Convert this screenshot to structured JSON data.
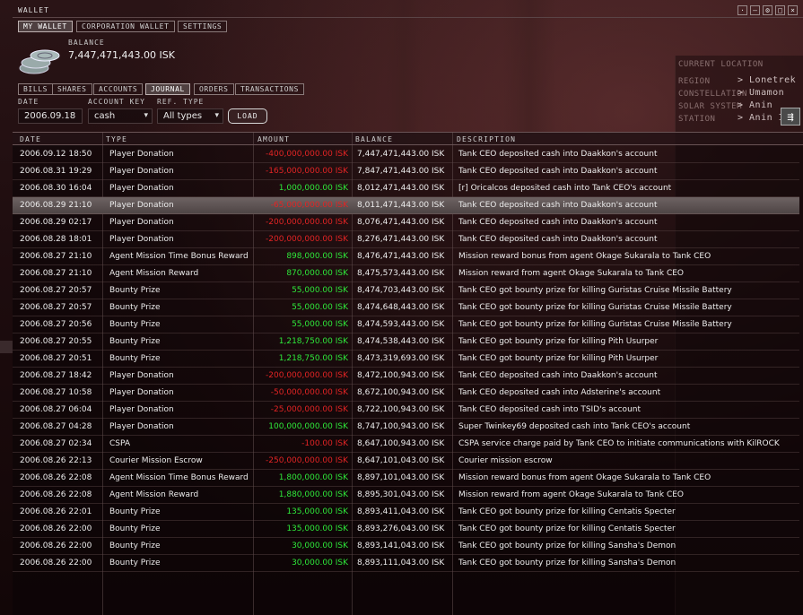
{
  "window": {
    "title": "WALLET"
  },
  "tabs_top": [
    "MY WALLET",
    "CORPORATION WALLET",
    "SETTINGS"
  ],
  "balance": {
    "label": "BALANCE",
    "value": "7,447,471,443.00 ISK"
  },
  "tabs_sub": [
    "BILLS",
    "SHARES",
    "ACCOUNTS",
    "JOURNAL",
    "ORDERS",
    "TRANSACTIONS"
  ],
  "filters": {
    "date_label": "DATE",
    "date_value": "2006.09.18",
    "account_label": "ACCOUNT KEY",
    "account_value": "cash",
    "ref_label": "REF. TYPE",
    "ref_value": "All types",
    "load_label": "LOAD"
  },
  "location": {
    "heading": "CURRENT LOCATION",
    "region_label": "REGION",
    "region_value": "> Lonetrek",
    "constellation_label": "CONSTELLATION",
    "constellation_value": "> Umamon",
    "system_label": "SOLAR SYSTEM",
    "system_value": "> Anin",
    "station_label": "STATION",
    "station_value": "> Anin IX"
  },
  "columns": [
    "DATE",
    "TYPE",
    "AMOUNT",
    "BALANCE",
    "DESCRIPTION"
  ],
  "rows": [
    {
      "date": "2006.09.12 18:50",
      "type": "Player Donation",
      "amount": "-400,000,000.00 ISK",
      "sign": "neg",
      "balance": "7,447,471,443.00 ISK",
      "desc": "Tank CEO deposited cash into Daakkon's account"
    },
    {
      "date": "2006.08.31 19:29",
      "type": "Player Donation",
      "amount": "-165,000,000.00 ISK",
      "sign": "neg",
      "balance": "7,847,471,443.00 ISK",
      "desc": "Tank CEO deposited cash into Daakkon's account"
    },
    {
      "date": "2006.08.30 16:04",
      "type": "Player Donation",
      "amount": "1,000,000.00 ISK",
      "sign": "pos",
      "balance": "8,012,471,443.00 ISK",
      "desc": "[r] Oricalcos deposited cash into Tank CEO's account"
    },
    {
      "date": "2006.08.29 21:10",
      "type": "Player Donation",
      "amount": "-65,000,000.00 ISK",
      "sign": "neg",
      "balance": "8,011,471,443.00 ISK",
      "desc": "Tank CEO deposited cash into Daakkon's account",
      "selected": true
    },
    {
      "date": "2006.08.29 02:17",
      "type": "Player Donation",
      "amount": "-200,000,000.00 ISK",
      "sign": "neg",
      "balance": "8,076,471,443.00 ISK",
      "desc": "Tank CEO deposited cash into Daakkon's account"
    },
    {
      "date": "2006.08.28 18:01",
      "type": "Player Donation",
      "amount": "-200,000,000.00 ISK",
      "sign": "neg",
      "balance": "8,276,471,443.00 ISK",
      "desc": "Tank CEO deposited cash into Daakkon's account"
    },
    {
      "date": "2006.08.27 21:10",
      "type": "Agent Mission Time Bonus Reward",
      "amount": "898,000.00 ISK",
      "sign": "pos",
      "balance": "8,476,471,443.00 ISK",
      "desc": "Mission reward bonus from agent Okage Sukarala to Tank CEO"
    },
    {
      "date": "2006.08.27 21:10",
      "type": "Agent Mission Reward",
      "amount": "870,000.00 ISK",
      "sign": "pos",
      "balance": "8,475,573,443.00 ISK",
      "desc": "Mission reward from agent Okage Sukarala to Tank CEO"
    },
    {
      "date": "2006.08.27 20:57",
      "type": "Bounty Prize",
      "amount": "55,000.00 ISK",
      "sign": "pos",
      "balance": "8,474,703,443.00 ISK",
      "desc": "Tank CEO got bounty prize for killing Guristas Cruise Missile Battery"
    },
    {
      "date": "2006.08.27 20:57",
      "type": "Bounty Prize",
      "amount": "55,000.00 ISK",
      "sign": "pos",
      "balance": "8,474,648,443.00 ISK",
      "desc": "Tank CEO got bounty prize for killing Guristas Cruise Missile Battery"
    },
    {
      "date": "2006.08.27 20:56",
      "type": "Bounty Prize",
      "amount": "55,000.00 ISK",
      "sign": "pos",
      "balance": "8,474,593,443.00 ISK",
      "desc": "Tank CEO got bounty prize for killing Guristas Cruise Missile Battery"
    },
    {
      "date": "2006.08.27 20:55",
      "type": "Bounty Prize",
      "amount": "1,218,750.00 ISK",
      "sign": "pos",
      "balance": "8,474,538,443.00 ISK",
      "desc": "Tank CEO got bounty prize for killing Pith Usurper"
    },
    {
      "date": "2006.08.27 20:51",
      "type": "Bounty Prize",
      "amount": "1,218,750.00 ISK",
      "sign": "pos",
      "balance": "8,473,319,693.00 ISK",
      "desc": "Tank CEO got bounty prize for killing Pith Usurper"
    },
    {
      "date": "2006.08.27 18:42",
      "type": "Player Donation",
      "amount": "-200,000,000.00 ISK",
      "sign": "neg",
      "balance": "8,472,100,943.00 ISK",
      "desc": "Tank CEO deposited cash into Daakkon's account"
    },
    {
      "date": "2006.08.27 10:58",
      "type": "Player Donation",
      "amount": "-50,000,000.00 ISK",
      "sign": "neg",
      "balance": "8,672,100,943.00 ISK",
      "desc": "Tank CEO deposited cash into Adsterine's account"
    },
    {
      "date": "2006.08.27 06:04",
      "type": "Player Donation",
      "amount": "-25,000,000.00 ISK",
      "sign": "neg",
      "balance": "8,722,100,943.00 ISK",
      "desc": "Tank CEO deposited cash into TSID's account"
    },
    {
      "date": "2006.08.27 04:28",
      "type": "Player Donation",
      "amount": "100,000,000.00 ISK",
      "sign": "pos",
      "balance": "8,747,100,943.00 ISK",
      "desc": "Super Twinkey69 deposited cash into Tank CEO's account"
    },
    {
      "date": "2006.08.27 02:34",
      "type": "CSPA",
      "amount": "-100.00 ISK",
      "sign": "neg",
      "balance": "8,647,100,943.00 ISK",
      "desc": "CSPA service charge paid by Tank CEO to initiate communications with KilROCK"
    },
    {
      "date": "2006.08.26 22:13",
      "type": "Courier Mission Escrow",
      "amount": "-250,000,000.00 ISK",
      "sign": "neg",
      "balance": "8,647,101,043.00 ISK",
      "desc": "Courier mission escrow"
    },
    {
      "date": "2006.08.26 22:08",
      "type": "Agent Mission Time Bonus Reward",
      "amount": "1,800,000.00 ISK",
      "sign": "pos",
      "balance": "8,897,101,043.00 ISK",
      "desc": "Mission reward bonus from agent Okage Sukarala to Tank CEO"
    },
    {
      "date": "2006.08.26 22:08",
      "type": "Agent Mission Reward",
      "amount": "1,880,000.00 ISK",
      "sign": "pos",
      "balance": "8,895,301,043.00 ISK",
      "desc": "Mission reward from agent Okage Sukarala to Tank CEO"
    },
    {
      "date": "2006.08.26 22:01",
      "type": "Bounty Prize",
      "amount": "135,000.00 ISK",
      "sign": "pos",
      "balance": "8,893,411,043.00 ISK",
      "desc": "Tank CEO got bounty prize for killing Centatis Specter"
    },
    {
      "date": "2006.08.26 22:00",
      "type": "Bounty Prize",
      "amount": "135,000.00 ISK",
      "sign": "pos",
      "balance": "8,893,276,043.00 ISK",
      "desc": "Tank CEO got bounty prize for killing Centatis Specter"
    },
    {
      "date": "2006.08.26 22:00",
      "type": "Bounty Prize",
      "amount": "30,000.00 ISK",
      "sign": "pos",
      "balance": "8,893,141,043.00 ISK",
      "desc": "Tank CEO got bounty prize for killing Sansha's Demon"
    },
    {
      "date": "2006.08.26 22:00",
      "type": "Bounty Prize",
      "amount": "30,000.00 ISK",
      "sign": "pos",
      "balance": "8,893,111,043.00 ISK",
      "desc": "Tank CEO got bounty prize for killing Sansha's Demon"
    }
  ],
  "colors": {
    "positive": "#2ee83a",
    "negative": "#e22424",
    "selected_row": "#6e6363"
  }
}
